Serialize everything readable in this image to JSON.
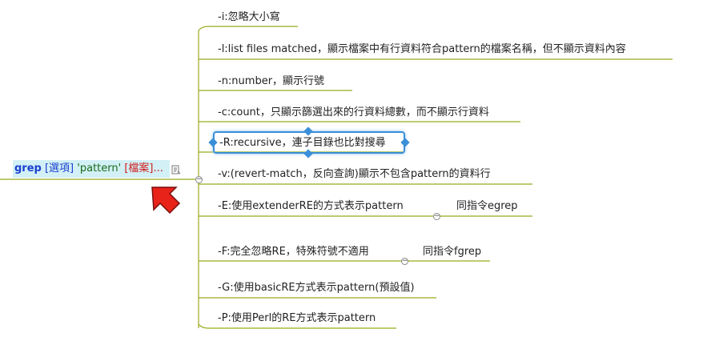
{
  "root": {
    "cmd": "grep",
    "opt": "[選項]",
    "pattern": "'pattern'",
    "file": "[檔案]...",
    "note_icon": "note-icon"
  },
  "options": [
    {
      "label": "-i:忽略大小寫"
    },
    {
      "label": "-l:list files matched，顯示檔案中有行資料符合pattern的檔案名稱，但不顯示資料內容"
    },
    {
      "label": "-n:number，顯示行號"
    },
    {
      "label": "-c:count，只顯示篩選出來的行資料總數，而不顯示行資料"
    },
    {
      "label": "-R:recursive，連子目錄也比對搜尋"
    },
    {
      "label": "-v:(revert-match，反向查詢)顯示不包含pattern的資料行"
    },
    {
      "label": "-E:使用extenderRE的方式表示pattern",
      "sub": "同指令egrep"
    },
    {
      "label": "-F:完全忽略RE，特殊符號不適用",
      "sub": "同指令fgrep"
    },
    {
      "label": "-G:使用basicRE方式表示pattern(預設值)"
    },
    {
      "label": "-P:使用Perl的RE方式表示pattern"
    }
  ],
  "colors": {
    "line": "#9aaa1c",
    "selection": "#3a8fd8",
    "root_bg": "#d2f0f6",
    "arrow": "#e8231a"
  }
}
